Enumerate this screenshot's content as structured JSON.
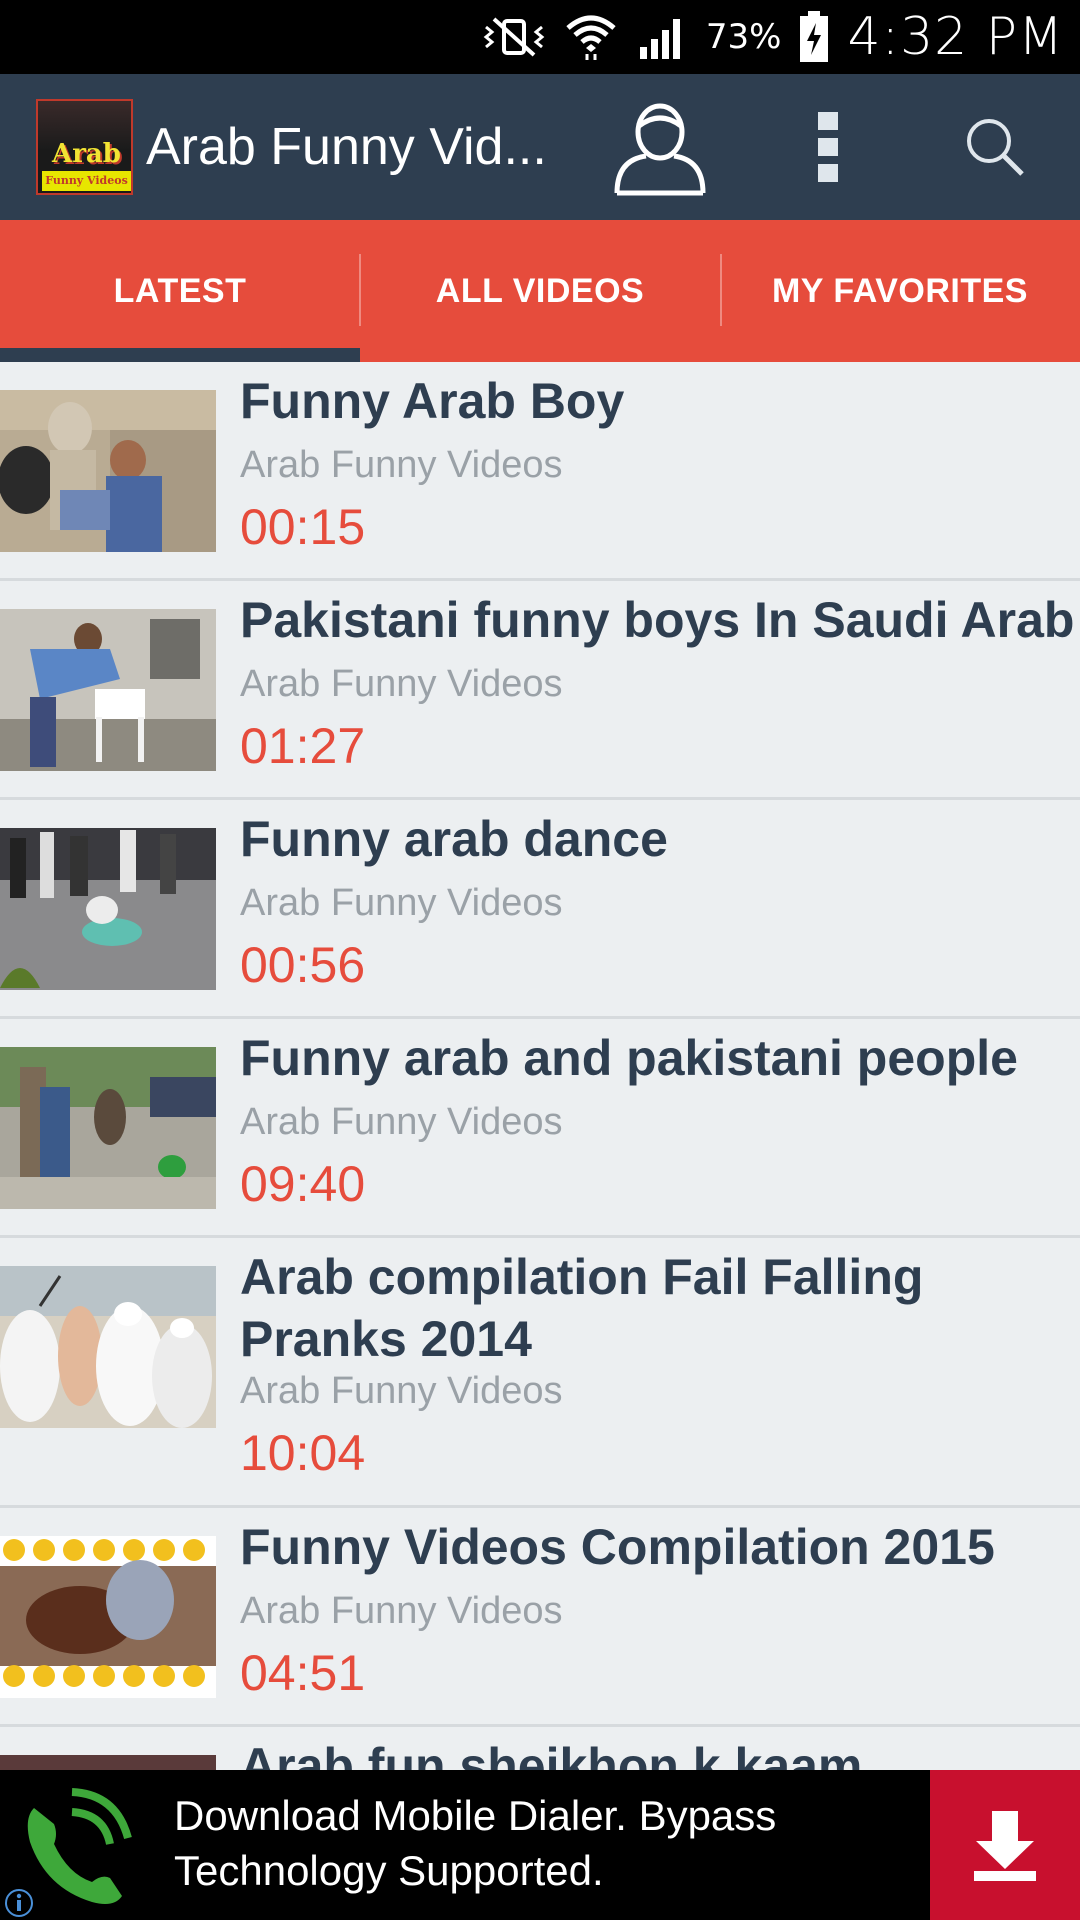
{
  "status_bar": {
    "battery": "73%",
    "time": "4:32 PM",
    "icons": [
      "mute-vibrate-icon",
      "wifi-icon",
      "signal-icon",
      "battery-icon"
    ]
  },
  "app_bar": {
    "title": "Arab Funny Vid...",
    "logo_text": "Arab",
    "logo_subtext": "Funny Videos",
    "icons": [
      "user-icon",
      "more-vert-icon",
      "search-icon"
    ]
  },
  "tabs": [
    {
      "label": "LATEST",
      "selected": true
    },
    {
      "label": "ALL VIDEOS",
      "selected": false
    },
    {
      "label": "MY FAVORITES",
      "selected": false
    }
  ],
  "videos": [
    {
      "title": "Funny Arab Boy",
      "channel": "Arab Funny Videos",
      "duration": "00:15"
    },
    {
      "title": "Pakistani funny boys In Saudi Arab",
      "channel": "Arab Funny Videos",
      "duration": "01:27"
    },
    {
      "title": "Funny arab dance",
      "channel": "Arab Funny Videos",
      "duration": "00:56"
    },
    {
      "title": "Funny arab and pakistani people",
      "channel": "Arab Funny Videos",
      "duration": "09:40"
    },
    {
      "title": "Arab compilation Fail Falling Pranks 2014",
      "channel": "Arab Funny Videos",
      "duration": "10:04"
    },
    {
      "title": "Funny Videos Compilation 2015",
      "channel": "Arab Funny Videos",
      "duration": "04:51"
    },
    {
      "title": "Arab fun sheikhon k kaam",
      "channel": "",
      "duration": ""
    }
  ],
  "ad": {
    "text": "Download Mobile Dialer. Bypass Technology Supported.",
    "icons": [
      "phone-icon",
      "download-icon",
      "info-icon"
    ]
  },
  "colors": {
    "app_bar": "#2e3e50",
    "tab_bar": "#e64c3c",
    "accent_red": "#e64c3c",
    "title_text": "#2e3e50",
    "channel_text": "#9aa1a7",
    "list_bg": "#eceff1",
    "ad_download_bg": "#c8102e"
  }
}
